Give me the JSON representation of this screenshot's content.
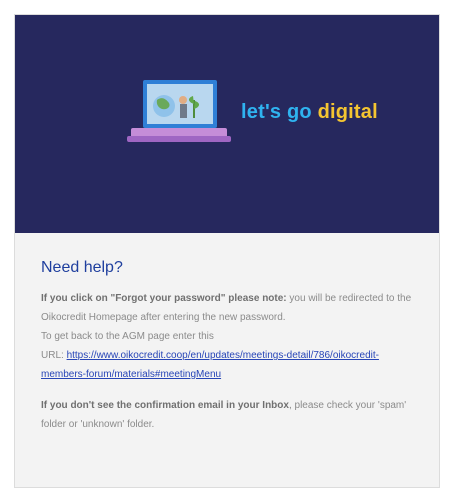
{
  "banner": {
    "text_light": "let's go ",
    "text_strong": "digital",
    "icon": "laptop-icon",
    "background": "#26285e",
    "accent_light": "#2fb3f0",
    "accent_strong": "#f4c531"
  },
  "help": {
    "title": "Need help?",
    "para1_bold": "If you click on \"Forgot your password\" please note:",
    "para1_text": " you will be redirected to the Oikocredit Homepage after entering the new password.",
    "para2_line1": "To get back to the AGM page enter this",
    "para2_prefix": "URL: ",
    "para2_link": "https://www.oikocredit.coop/en/updates/meetings-detail/786/oikocredit-members-forum/materials#meetingMenu",
    "para3_bold": "If you don't see the confirmation email in your Inbox",
    "para3_text": ", please check your 'spam' folder or 'unknown' folder."
  }
}
